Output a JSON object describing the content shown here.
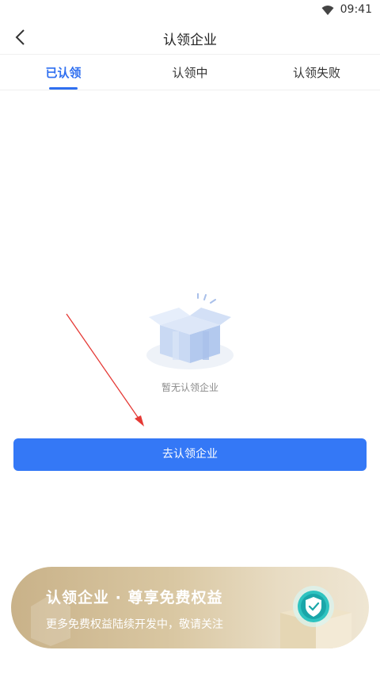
{
  "status_bar": {
    "time": "09:41",
    "wifi_icon": "wifi-icon"
  },
  "nav": {
    "title": "认领企业",
    "back_icon": "chevron-left-icon"
  },
  "tabs": [
    {
      "label": "已认领",
      "active": true
    },
    {
      "label": "认领中",
      "active": false
    },
    {
      "label": "认领失败",
      "active": false
    }
  ],
  "empty_state": {
    "text": "暂无认领企业",
    "illustration": "empty-box-icon"
  },
  "claim_button": {
    "label": "去认领企业"
  },
  "promo": {
    "title": "认领企业 · 尊享免费权益",
    "subtitle": "更多免费权益陆续开发中，敬请关注",
    "badge_icon": "shield-check-icon"
  },
  "colors": {
    "accent": "#3478f6",
    "tab_active": "#2f6ff0",
    "annotation_arrow": "#e53935",
    "promo_gold": "#c9b289"
  }
}
